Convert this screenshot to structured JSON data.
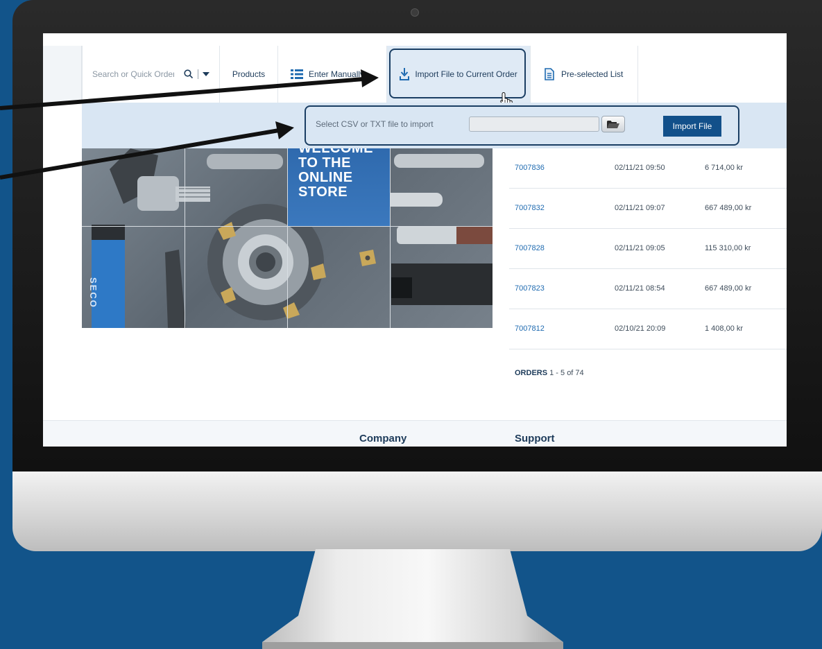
{
  "nav": {
    "search_placeholder": "Search or Quick Order",
    "products_label": "Products",
    "enter_manually_label": "Enter Manually",
    "import_file_label": "Import File to Current Order",
    "preselected_label": "Pre-selected List"
  },
  "import_bar": {
    "label": "Select CSV or TXT file to import",
    "file_value": "",
    "button_label": "Import File"
  },
  "hero": {
    "lines": [
      "WELCOME",
      "TO THE",
      "ONLINE",
      "STORE"
    ],
    "brand_text": "SECO"
  },
  "orders": {
    "rows": [
      {
        "number": "7007836",
        "date": "02/11/21 09:50",
        "amount": "6 714,00 kr"
      },
      {
        "number": "7007832",
        "date": "02/11/21 09:07",
        "amount": "667 489,00 kr"
      },
      {
        "number": "7007828",
        "date": "02/11/21 09:05",
        "amount": "115 310,00 kr"
      },
      {
        "number": "7007823",
        "date": "02/11/21 08:54",
        "amount": "667 489,00 kr"
      },
      {
        "number": "7007812",
        "date": "02/10/21 20:09",
        "amount": "1 408,00 kr"
      }
    ],
    "count_label": "ORDERS",
    "count_text": "1 - 5 of 74"
  },
  "footer": {
    "company_heading": "Company",
    "support_heading": "Support"
  },
  "colors": {
    "background": "#12548a",
    "primary": "#12508a",
    "highlight_border": "#1a3e63",
    "import_bar": "#d9e6f3",
    "link": "#1e6ab0"
  },
  "icons": {
    "search": "search-icon",
    "dropdown": "chevron-down-icon",
    "enter_manually": "list-icon",
    "import_file": "download-tray-icon",
    "preselected": "document-icon",
    "browse": "folder-open-icon",
    "cursor": "hand-pointer-icon"
  }
}
